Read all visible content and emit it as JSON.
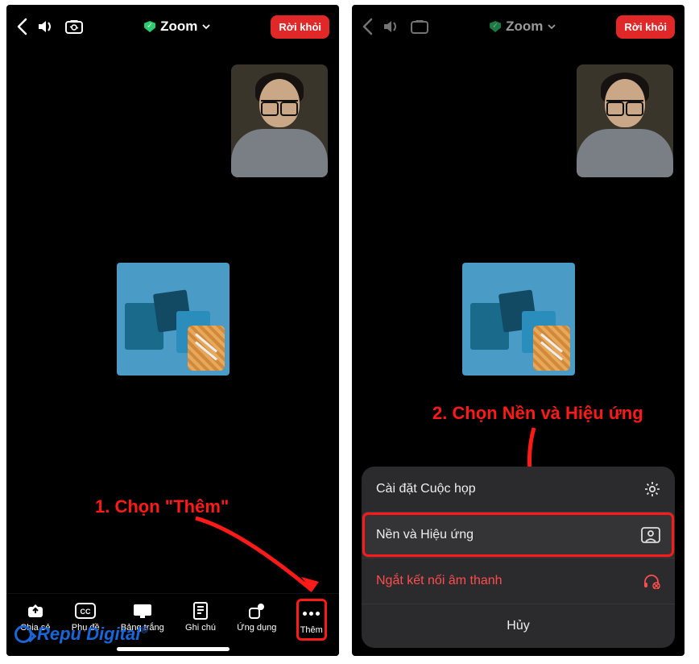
{
  "header": {
    "title": "Zoom",
    "leave_label": "Rời khỏi"
  },
  "annotations": {
    "step1": "1. Chọn \"Thêm\"",
    "step2": "2. Chọn Nền và Hiệu ứng"
  },
  "toolbar": {
    "share": {
      "label": "Chia sẻ"
    },
    "caption": {
      "label": "Phụ đề"
    },
    "whiteboard": {
      "label": "Bảng trắng"
    },
    "notes": {
      "label": "Ghi chú"
    },
    "apps": {
      "label": "Ứng dụng"
    },
    "more": {
      "label": "Thêm"
    }
  },
  "sheet": {
    "meeting_settings": "Cài đặt Cuộc họp",
    "bg_effects": "Nền và Hiệu ứng",
    "disconnect_audio": "Ngắt kết nối âm thanh",
    "cancel": "Hủy"
  },
  "watermark": "Repu Digital"
}
